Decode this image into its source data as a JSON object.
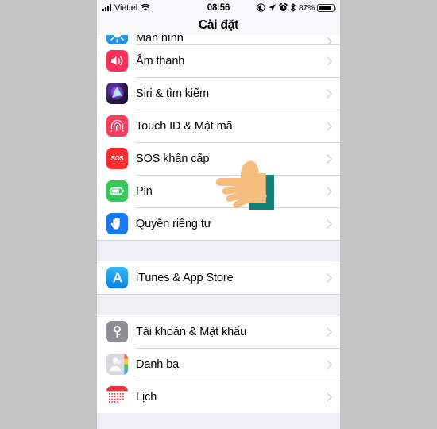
{
  "device": {
    "frame_background": "#c3c3c3",
    "screen_background": "#efeff4"
  },
  "status_bar": {
    "carrier": "Viettel",
    "signal_icon": "signal-bars-icon",
    "wifi_icon": "wifi-icon",
    "time": "08:56",
    "do_not_disturb_icon": "do-not-disturb-icon",
    "location_icon": "location-arrow-icon",
    "alarm_icon": "alarm-clock-icon",
    "bluetooth_icon": "bluetooth-icon",
    "battery_percent": "87%",
    "battery_icon": "battery-icon"
  },
  "nav_bar": {
    "title": "Cài đặt"
  },
  "colors": {
    "sound": "#fc3158",
    "siri": "#2b1b4d",
    "touch_id": "#fb3a5d",
    "sos": "#fa2d2d",
    "battery": "#34c85a",
    "privacy": "#1878f0",
    "itunes": "#0a82ea",
    "account": "#8e8e93",
    "contacts": "#d8d8dc",
    "calendar": "#f4303c",
    "chevron": "#c2c2c7",
    "separator": "#d6d6da"
  },
  "cursor": {
    "type": "pointing-hand-cursor",
    "skin_color": "#f5be7e",
    "sleeve_color": "#13807a",
    "target_row": "Pin"
  },
  "sections": [
    {
      "id": "section-display",
      "rows": [
        {
          "label": "Màn hình",
          "icon": "display-brightness-icon",
          "icon_class": "ic-display",
          "clipped": true
        },
        {
          "label": "Âm thanh",
          "icon": "speaker-icon",
          "icon_class": "ic-sound",
          "clipped": false
        },
        {
          "label": "Siri & tìm kiếm",
          "icon": "siri-icon",
          "icon_class": "ic-siri",
          "clipped": false
        },
        {
          "label": "Touch ID & Mật mã",
          "icon": "fingerprint-icon",
          "icon_class": "ic-touchid",
          "clipped": false
        },
        {
          "label": "SOS khẩn cấp",
          "icon": "sos-icon",
          "icon_class": "ic-sos",
          "clipped": false
        },
        {
          "label": "Pin",
          "icon": "battery-settings-icon",
          "icon_class": "ic-battery",
          "clipped": false
        },
        {
          "label": "Quyền riêng tư",
          "icon": "privacy-hand-icon",
          "icon_class": "ic-privacy",
          "clipped": false
        }
      ]
    },
    {
      "id": "section-store",
      "rows": [
        {
          "label": "iTunes & App Store",
          "icon": "app-store-icon",
          "icon_class": "ic-itunes",
          "clipped": false
        }
      ]
    },
    {
      "id": "section-accounts",
      "rows": [
        {
          "label": "Tài khoản & Mật khẩu",
          "icon": "key-icon",
          "icon_class": "ic-account",
          "clipped": false
        },
        {
          "label": "Danh bạ",
          "icon": "contacts-icon",
          "icon_class": "ic-contacts",
          "clipped": false
        },
        {
          "label": "Lịch",
          "icon": "calendar-icon",
          "icon_class": "ic-calendar",
          "clipped": false
        }
      ]
    }
  ]
}
